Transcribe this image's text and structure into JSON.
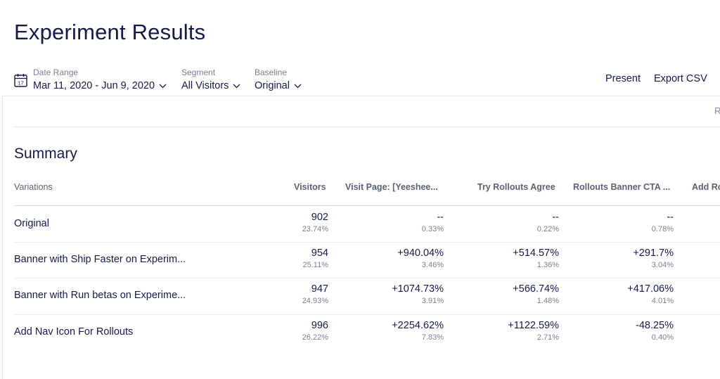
{
  "page": {
    "title": "Experiment Results"
  },
  "filters": {
    "date_range": {
      "label": "Date Range",
      "value": "Mar 11, 2020 - Jun 9, 2020",
      "icon_day": "17"
    },
    "segment": {
      "label": "Segment",
      "value": "All Visitors"
    },
    "baseline": {
      "label": "Baseline",
      "value": "Original"
    }
  },
  "actions": {
    "present": "Present",
    "export_csv": "Export CSV"
  },
  "clipped_text": "R",
  "summary": {
    "title": "Summary",
    "columns": [
      "Variations",
      "Visitors",
      "Visit Page: [Yeeshee...",
      "Try Rollouts Agree",
      "Rollouts Banner CTA ...",
      "Add Ro"
    ],
    "rows": [
      {
        "name": "Original",
        "visitors": "902",
        "visitors_pct": "23.74%",
        "metrics": [
          {
            "main": "--",
            "sub": "0.33%"
          },
          {
            "main": "--",
            "sub": "0.22%"
          },
          {
            "main": "--",
            "sub": "0.78%"
          }
        ]
      },
      {
        "name": "Banner with Ship Faster on Experim...",
        "visitors": "954",
        "visitors_pct": "25.11%",
        "metrics": [
          {
            "main": "+940.04%",
            "sub": "3.46%"
          },
          {
            "main": "+514.57%",
            "sub": "1.36%"
          },
          {
            "main": "+291.7%",
            "sub": "3.04%"
          }
        ]
      },
      {
        "name": "Banner with Run betas on Experime...",
        "visitors": "947",
        "visitors_pct": "24.93%",
        "metrics": [
          {
            "main": "+1074.73%",
            "sub": "3.91%"
          },
          {
            "main": "+566.74%",
            "sub": "1.48%"
          },
          {
            "main": "+417.06%",
            "sub": "4.01%"
          }
        ]
      },
      {
        "name": "Add Nav Icon For Rollouts",
        "visitors": "996",
        "visitors_pct": "26.22%",
        "metrics": [
          {
            "main": "+2254.62%",
            "sub": "7.83%"
          },
          {
            "main": "+1122.59%",
            "sub": "2.71%"
          },
          {
            "main": "-48.25%",
            "sub": "0.40%"
          }
        ]
      }
    ]
  }
}
